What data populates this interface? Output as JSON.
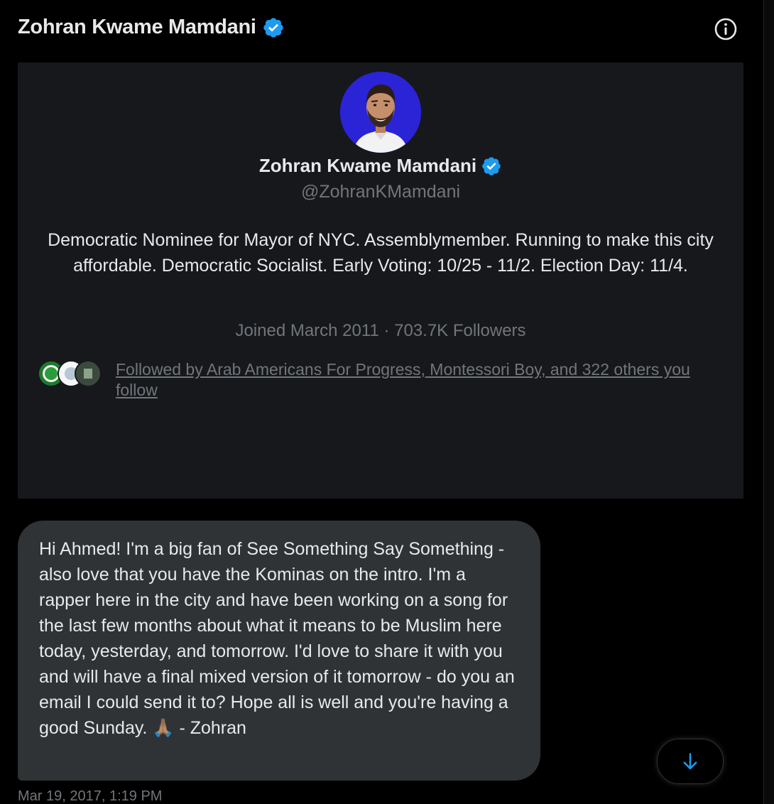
{
  "header": {
    "title": "Zohran Kwame Mamdani",
    "verified_icon": "verified-badge-icon",
    "info_icon": "info-icon"
  },
  "profile": {
    "name": "Zohran Kwame Mamdani",
    "handle": "@ZohranKMamdani",
    "bio": "Democratic Nominee for Mayor of NYC. Assemblymember. Running to make this city affordable. Democratic Socialist. Early Voting: 10/25 - 11/2. Election Day: 11/4.",
    "meta": "Joined March 2011 · 703.7K Followers",
    "followed_by": "Followed by Arab Americans For Progress, Montessori Boy, and 322 others you follow"
  },
  "message": {
    "text": "Hi Ahmed! I'm a big fan of See Something Say Something - also love that you have the Kominas on the intro. I'm a rapper here in the city and have been working on a song for the last few months about what it means to be Muslim here today, yesterday, and tomorrow. I'd love to share it with you and will have a final mixed version of it tomorrow - do you an email I could send it to? Hope all is well and you're having a good Sunday. 🙏🏽 - Zohran",
    "timestamp": "Mar 19, 2017, 1:19 PM"
  },
  "colors": {
    "background": "#000000",
    "card": "#16181c",
    "bubble": "#2f3336",
    "verified": "#1d9bf0",
    "secondary_text": "#71767b",
    "primary_text": "#e7e9ea",
    "avatar_bg": "#2a24d6"
  },
  "icons": {
    "scroll_down": "arrow-down-icon"
  }
}
